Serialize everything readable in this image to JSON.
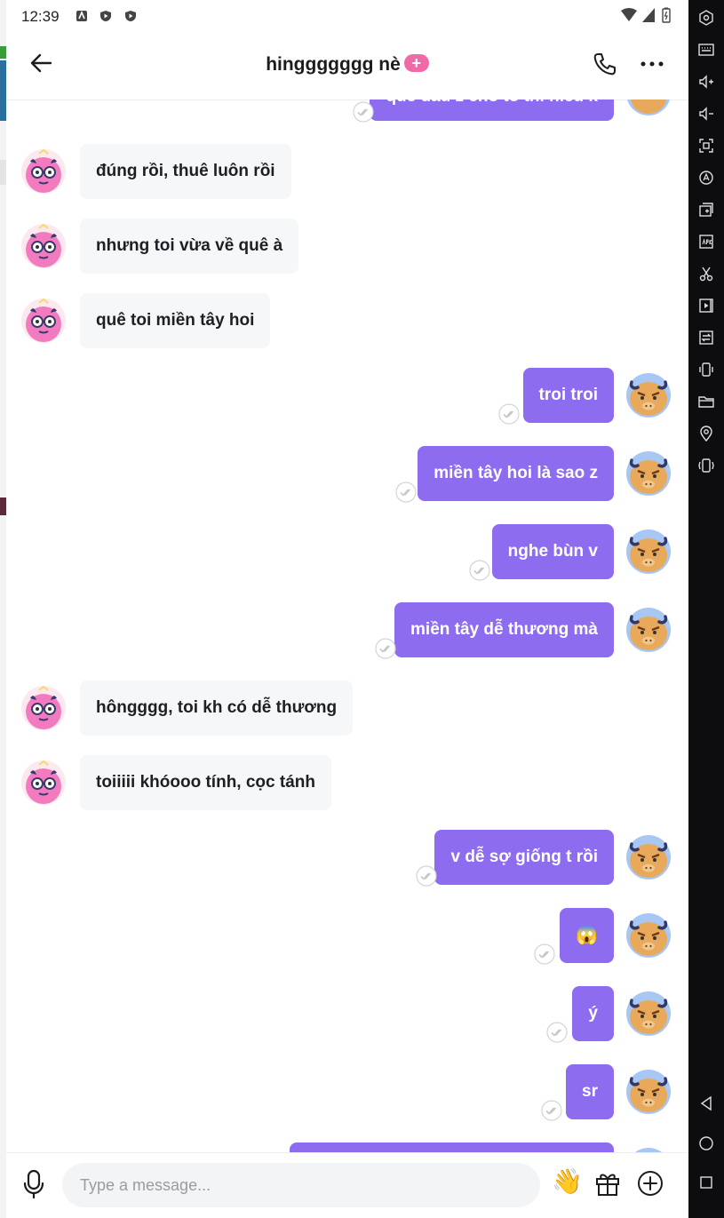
{
  "status_bar": {
    "time": "12:39"
  },
  "header": {
    "title": "hinggggggg nè",
    "badge": "+"
  },
  "messages": [
    {
      "side": "out",
      "text": "quê đâu z cho to thì hiểu k"
    },
    {
      "side": "in",
      "text": "đúng rồi, thuê luôn rồi"
    },
    {
      "side": "in",
      "text": "nhưng toi vừa về quê à"
    },
    {
      "side": "in",
      "text": "quê toi miền tây hoi"
    },
    {
      "side": "out",
      "text": "troi troi"
    },
    {
      "side": "out",
      "text": "miền tây hoi là sao z"
    },
    {
      "side": "out",
      "text": "nghe bùn v"
    },
    {
      "side": "out",
      "text": "miền tây dễ thương mà"
    },
    {
      "side": "in",
      "text": "hôngggg, toi kh có dễ thương"
    },
    {
      "side": "in",
      "text": "toiiiii khóooo tính, cọc tánh"
    },
    {
      "side": "out",
      "text": "v dễ sợ giống t rồi"
    },
    {
      "side": "out",
      "text": "😱"
    },
    {
      "side": "out",
      "text": "ý"
    },
    {
      "side": "out",
      "text": "sr"
    }
  ],
  "composer": {
    "placeholder": "Type a message...",
    "wave_emoji": "👋"
  },
  "icons": [
    "back-arrow-icon",
    "phone-icon",
    "more-icon",
    "mic-icon",
    "gift-icon",
    "add-circle-icon",
    "double-check-icon"
  ],
  "colors": {
    "outgoing_bubble": "#8e6cf0",
    "incoming_bubble": "#f6f7f9",
    "badge": "#f06aa8"
  }
}
